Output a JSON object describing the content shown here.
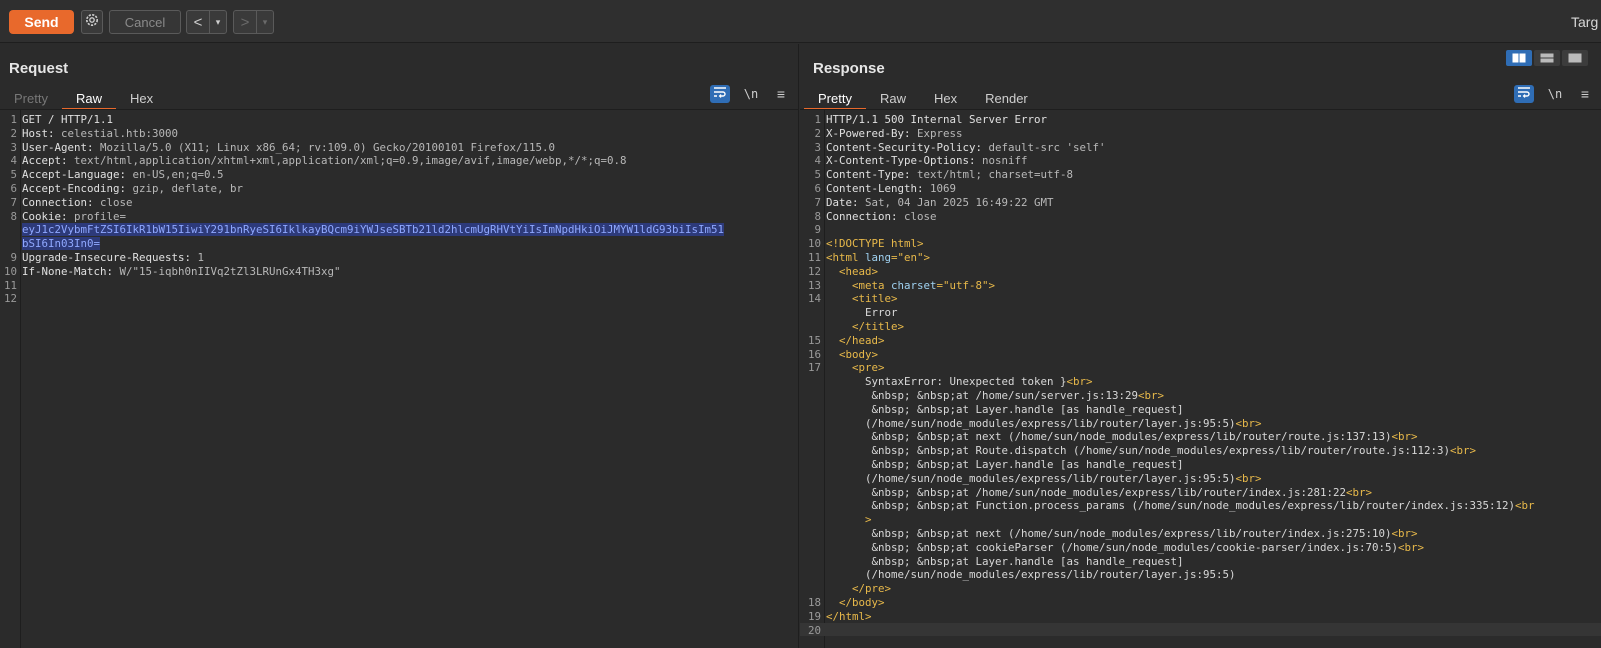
{
  "toolbar": {
    "send_label": "Send",
    "cancel_label": "Cancel",
    "back_label": "<",
    "forward_label": ">",
    "dropdown_glyph": "▾",
    "target_label": "Targ"
  },
  "request": {
    "title": "Request",
    "tabs": [
      "Pretty",
      "Raw",
      "Hex"
    ],
    "active_tab": "Raw",
    "newline_toggle": "\\n",
    "lines": [
      {
        "n": "1",
        "k": "GET / HTTP/1.1",
        "v": ""
      },
      {
        "n": "2",
        "k": "Host:",
        "v": " celestial.htb:3000"
      },
      {
        "n": "3",
        "k": "User-Agent:",
        "v": " Mozilla/5.0 (X11; Linux x86_64; rv:109.0) Gecko/20100101 Firefox/115.0"
      },
      {
        "n": "4",
        "k": "Accept:",
        "v": " text/html,application/xhtml+xml,application/xml;q=0.9,image/avif,image/webp,*/*;q=0.8"
      },
      {
        "n": "5",
        "k": "Accept-Language:",
        "v": " en-US,en;q=0.5"
      },
      {
        "n": "6",
        "k": "Accept-Encoding:",
        "v": " gzip, deflate, br"
      },
      {
        "n": "7",
        "k": "Connection:",
        "v": " close"
      },
      {
        "n": "8",
        "k": "Cookie:",
        "v": " profile="
      },
      {
        "n": "",
        "k": "",
        "v": "",
        "hl": "eyJ1c2VybmFtZSI6IkR1bW15IiwiY291bnRyeSI6IklkayBQcm9iYWJseSBTb21ld2hlcmUgRHVtYiIsImNpdHkiOiJMYW1ldG93biIsIm51"
      },
      {
        "n": "",
        "k": "",
        "v": "",
        "hl": "bSI6In03In0="
      },
      {
        "n": "9",
        "k": "Upgrade-Insecure-Requests:",
        "v": " 1"
      },
      {
        "n": "10",
        "k": "If-None-Match:",
        "v": " W/\"15-iqbh0nIIVq2tZl3LRUnGx4TH3xg\""
      },
      {
        "n": "11",
        "k": "",
        "v": ""
      },
      {
        "n": "12",
        "k": "",
        "v": ""
      }
    ]
  },
  "response": {
    "title": "Response",
    "tabs": [
      "Pretty",
      "Raw",
      "Hex",
      "Render"
    ],
    "active_tab": "Pretty",
    "newline_toggle": "\\n",
    "headers": [
      {
        "n": "1",
        "k": "HTTP/1.1 500 Internal Server Error",
        "v": ""
      },
      {
        "n": "2",
        "k": "X-Powered-By:",
        "v": " Express"
      },
      {
        "n": "3",
        "k": "Content-Security-Policy:",
        "v": " default-src 'self'"
      },
      {
        "n": "4",
        "k": "X-Content-Type-Options:",
        "v": " nosniff"
      },
      {
        "n": "5",
        "k": "Content-Type:",
        "v": " text/html; charset=utf-8"
      },
      {
        "n": "6",
        "k": "Content-Length:",
        "v": " 1069"
      },
      {
        "n": "7",
        "k": "Date:",
        "v": " Sat, 04 Jan 2025 16:49:22 GMT"
      },
      {
        "n": "8",
        "k": "Connection:",
        "v": " close"
      },
      {
        "n": "9",
        "k": "",
        "v": ""
      }
    ],
    "html_lines": [
      {
        "n": "10",
        "indent": "",
        "parts": [
          [
            "tag",
            "<!DOCTYPE html>"
          ]
        ]
      },
      {
        "n": "11",
        "indent": "",
        "parts": [
          [
            "tag",
            "<html "
          ],
          [
            "attr",
            "lang"
          ],
          [
            "tag",
            "=\"en\">"
          ]
        ]
      },
      {
        "n": "12",
        "indent": "  ",
        "parts": [
          [
            "tag",
            "<head>"
          ]
        ]
      },
      {
        "n": "13",
        "indent": "    ",
        "parts": [
          [
            "tag",
            "<meta "
          ],
          [
            "attr",
            "charset"
          ],
          [
            "tag",
            "=\"utf-8\">"
          ]
        ]
      },
      {
        "n": "14",
        "indent": "    ",
        "parts": [
          [
            "tag",
            "<title>"
          ]
        ]
      },
      {
        "n": "",
        "indent": "      ",
        "parts": [
          [
            "txt",
            "Error"
          ]
        ]
      },
      {
        "n": "",
        "indent": "    ",
        "parts": [
          [
            "tag",
            "</title>"
          ]
        ]
      },
      {
        "n": "15",
        "indent": "  ",
        "parts": [
          [
            "tag",
            "</head>"
          ]
        ]
      },
      {
        "n": "16",
        "indent": "  ",
        "parts": [
          [
            "tag",
            "<body>"
          ]
        ]
      },
      {
        "n": "17",
        "indent": "    ",
        "parts": [
          [
            "tag",
            "<pre>"
          ]
        ]
      },
      {
        "n": "",
        "indent": "      ",
        "parts": [
          [
            "txt",
            "SyntaxError: Unexpected token }"
          ],
          [
            "tag",
            "<br>"
          ]
        ]
      },
      {
        "n": "",
        "indent": "       ",
        "parts": [
          [
            "txt",
            "&nbsp; &nbsp;at /home/sun/server.js:13:29"
          ],
          [
            "tag",
            "<br>"
          ]
        ]
      },
      {
        "n": "",
        "indent": "       ",
        "parts": [
          [
            "txt",
            "&nbsp; &nbsp;at Layer.handle [as handle_request]"
          ]
        ]
      },
      {
        "n": "",
        "indent": "      ",
        "parts": [
          [
            "txt",
            "(/home/sun/node_modules/express/lib/router/layer.js:95:5)"
          ],
          [
            "tag",
            "<br>"
          ]
        ]
      },
      {
        "n": "",
        "indent": "       ",
        "parts": [
          [
            "txt",
            "&nbsp; &nbsp;at next (/home/sun/node_modules/express/lib/router/route.js:137:13)"
          ],
          [
            "tag",
            "<br>"
          ]
        ]
      },
      {
        "n": "",
        "indent": "       ",
        "parts": [
          [
            "txt",
            "&nbsp; &nbsp;at Route.dispatch (/home/sun/node_modules/express/lib/router/route.js:112:3)"
          ],
          [
            "tag",
            "<br>"
          ]
        ]
      },
      {
        "n": "",
        "indent": "       ",
        "parts": [
          [
            "txt",
            "&nbsp; &nbsp;at Layer.handle [as handle_request]"
          ]
        ]
      },
      {
        "n": "",
        "indent": "      ",
        "parts": [
          [
            "txt",
            "(/home/sun/node_modules/express/lib/router/layer.js:95:5)"
          ],
          [
            "tag",
            "<br>"
          ]
        ]
      },
      {
        "n": "",
        "indent": "       ",
        "parts": [
          [
            "txt",
            "&nbsp; &nbsp;at /home/sun/node_modules/express/lib/router/index.js:281:22"
          ],
          [
            "tag",
            "<br>"
          ]
        ]
      },
      {
        "n": "",
        "indent": "       ",
        "parts": [
          [
            "txt",
            "&nbsp; &nbsp;at Function.process_params (/home/sun/node_modules/express/lib/router/index.js:335:12)"
          ],
          [
            "tag",
            "<br"
          ]
        ]
      },
      {
        "n": "",
        "indent": "      ",
        "parts": [
          [
            "tag",
            ">"
          ]
        ]
      },
      {
        "n": "",
        "indent": "       ",
        "parts": [
          [
            "txt",
            "&nbsp; &nbsp;at next (/home/sun/node_modules/express/lib/router/index.js:275:10)"
          ],
          [
            "tag",
            "<br>"
          ]
        ]
      },
      {
        "n": "",
        "indent": "       ",
        "parts": [
          [
            "txt",
            "&nbsp; &nbsp;at cookieParser (/home/sun/node_modules/cookie-parser/index.js:70:5)"
          ],
          [
            "tag",
            "<br>"
          ]
        ]
      },
      {
        "n": "",
        "indent": "       ",
        "parts": [
          [
            "txt",
            "&nbsp; &nbsp;at Layer.handle [as handle_request]"
          ]
        ]
      },
      {
        "n": "",
        "indent": "      ",
        "parts": [
          [
            "txt",
            "(/home/sun/node_modules/express/lib/router/layer.js:95:5)"
          ]
        ]
      },
      {
        "n": "",
        "indent": "    ",
        "parts": [
          [
            "tag",
            "</pre>"
          ]
        ]
      },
      {
        "n": "18",
        "indent": "  ",
        "parts": [
          [
            "tag",
            "</body>"
          ]
        ]
      },
      {
        "n": "19",
        "indent": "",
        "parts": [
          [
            "tag",
            "</html>"
          ]
        ]
      },
      {
        "n": "20",
        "indent": "",
        "parts": []
      }
    ]
  }
}
